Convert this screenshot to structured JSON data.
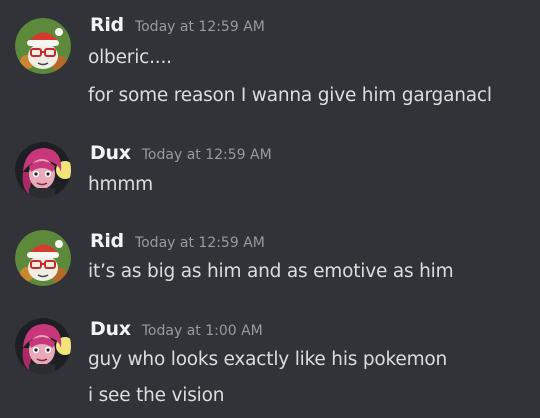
{
  "colors": {
    "background": "#313338",
    "username": "#f2f3f5",
    "timestamp": "#949ba4",
    "message_text": "#dbdee1"
  },
  "messages": [
    {
      "author": "Rid",
      "timestamp": "Today at 12:59 AM",
      "avatar_icon": "santa-hat-glasses-avatar-icon",
      "lines": [
        "olberic....",
        "for some reason I wanna give him garganacl"
      ]
    },
    {
      "author": "Dux",
      "timestamp": "Today at 12:59 AM",
      "avatar_icon": "pink-hair-character-avatar-icon",
      "lines": [
        "hmmm"
      ]
    },
    {
      "author": "Rid",
      "timestamp": "Today at 12:59 AM",
      "avatar_icon": "santa-hat-glasses-avatar-icon",
      "lines": [
        "it’s as big as him and as emotive as him"
      ]
    },
    {
      "author": "Dux",
      "timestamp": "Today at 1:00 AM",
      "avatar_icon": "pink-hair-character-avatar-icon",
      "lines": [
        "guy who looks exactly like his pokemon",
        "i see the vision"
      ]
    }
  ]
}
